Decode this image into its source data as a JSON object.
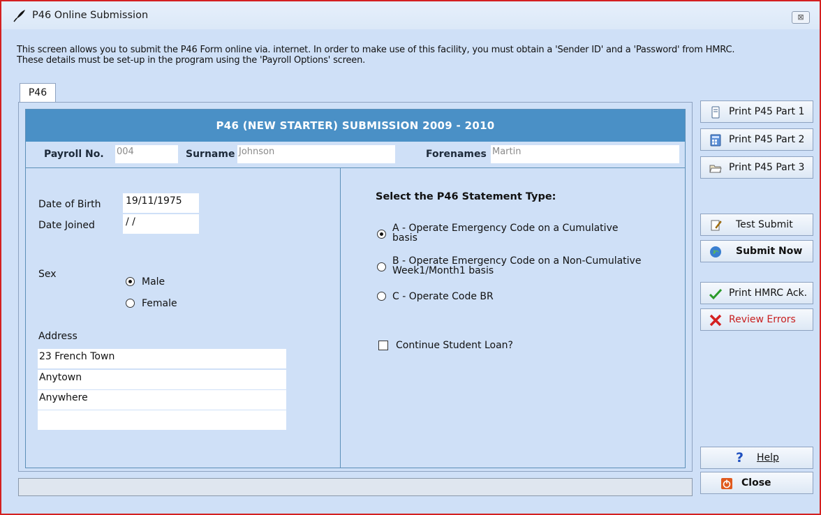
{
  "window": {
    "title": "P46 Online Submission",
    "close_glyph": "⊠"
  },
  "intro": {
    "line1": "This screen allows you to submit the P46 Form online via. internet. In order to make use of this facility, you must obtain a 'Sender ID' and a 'Password' from HMRC.",
    "line2": "These details must be set-up in the program using the 'Payroll Options' screen."
  },
  "tab": {
    "label": "P46"
  },
  "banner": {
    "title": "P46 (NEW STARTER) SUBMISSION 2009 - 2010"
  },
  "employee": {
    "payroll_label": "Payroll No.",
    "payroll_value": "004",
    "surname_label": "Surname",
    "surname_value": "Johnson",
    "forenames_label": "Forenames",
    "forenames_value": "Martin"
  },
  "details": {
    "dob_label": "Date of Birth",
    "dob_value": "19/11/1975",
    "joined_label": "Date Joined",
    "joined_value": " / /",
    "sex_label": "Sex",
    "sex_options": [
      "Male",
      "Female"
    ],
    "sex_selected": "Male",
    "address_label": "Address",
    "address_lines": [
      "23 French Town",
      "Anytown",
      "Anywhere",
      ""
    ]
  },
  "statement": {
    "heading": "Select the P46 Statement Type:",
    "options": [
      {
        "line1": "A - Operate Emergency Code on a Cumulative",
        "line2": "basis",
        "selected": true
      },
      {
        "line1": "B - Operate Emergency Code on a Non-Cumulative",
        "line2": "Week1/Month1 basis",
        "selected": false
      },
      {
        "line1": "C - Operate Code BR",
        "line2": "",
        "selected": false
      }
    ],
    "student_loan_label": "Continue Student Loan?",
    "student_loan_checked": false
  },
  "buttons": {
    "print_p45_part1": "Print P45 Part 1",
    "print_p45_part2": "Print P45 Part 2",
    "print_p45_part3": "Print P45 Part 3",
    "test_submit": "Test Submit",
    "submit_now": "Submit Now",
    "print_hmrc_ack": "Print HMRC Ack.",
    "review_errors": "Review Errors",
    "help": "Help",
    "close": "Close"
  },
  "colors": {
    "banner": "#4a90c6",
    "window_bg": "#cfe0f7",
    "review_errors_text": "#c81e1e",
    "close_icon": "#e05a1e"
  }
}
